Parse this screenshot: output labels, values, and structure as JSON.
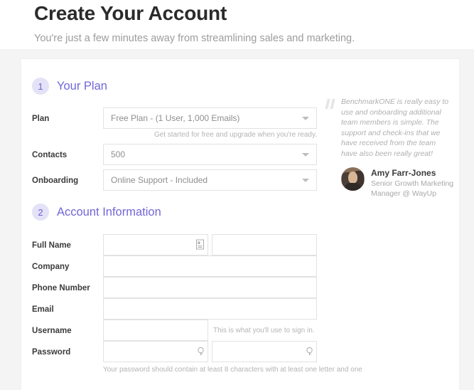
{
  "header": {
    "title": "Create Your Account",
    "subtitle": "You're just a few minutes away from streamlining sales and marketing."
  },
  "plan_section": {
    "badge": "1",
    "title": "Your Plan",
    "fields": {
      "plan": {
        "label": "Plan",
        "value": "Free Plan - (1 User, 1,000 Emails)",
        "helper": "Get started for free and upgrade when you're ready."
      },
      "contacts": {
        "label": "Contacts",
        "value": "500"
      },
      "onboarding": {
        "label": "Onboarding",
        "value": "Online Support - Included"
      }
    }
  },
  "account_section": {
    "badge": "2",
    "title": "Account Information",
    "fields": {
      "full_name": {
        "label": "Full Name",
        "first_value": "",
        "last_value": "",
        "icon": "contact-card-icon"
      },
      "company": {
        "label": "Company",
        "value": ""
      },
      "phone": {
        "label": "Phone Number",
        "value": ""
      },
      "email": {
        "label": "Email",
        "value": ""
      },
      "username": {
        "label": "Username",
        "value": "",
        "helper": "This is what you'll use to sign in."
      },
      "password": {
        "label": "Password",
        "value": "",
        "confirm_value": "",
        "icon": "key-icon",
        "helper": "Your password should contain at least 8 characters with at least one letter and one"
      }
    }
  },
  "testimonial": {
    "quote": "BenchmarkONE is really easy to use and onboarding additional team members is simple. The support and check-ins that we have received from the team have also been really great!",
    "author_name": "Amy Farr-Jones",
    "author_role": "Senior Growth Marketing Manager @ WayUp"
  },
  "colors": {
    "accent": "#6f67d6",
    "badge_bg": "#e3e2f7",
    "page_bg": "#f4f4f4",
    "text": "#3b3b3b",
    "muted": "#b4b4b4"
  }
}
